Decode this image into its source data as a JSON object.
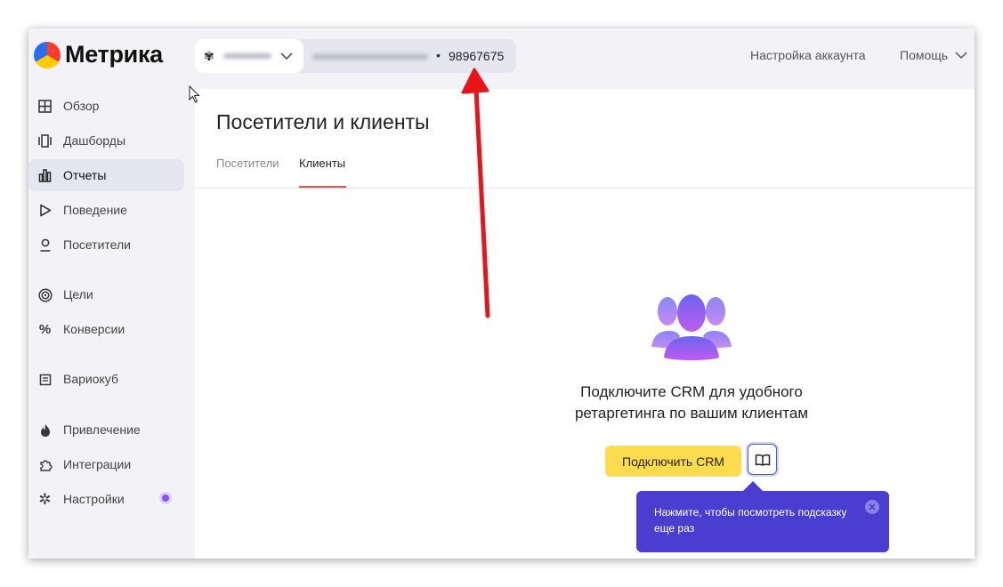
{
  "app": {
    "logo_text": "Метрика"
  },
  "header": {
    "counter_id": "98967675",
    "account_settings": "Настройка аккаунта",
    "help": "Помощь"
  },
  "sidebar": {
    "items": [
      {
        "label": "Обзор",
        "icon": "grid-icon"
      },
      {
        "label": "Дашборды",
        "icon": "dashboards-icon"
      },
      {
        "label": "Отчеты",
        "icon": "bar-chart-icon",
        "active": true
      },
      {
        "label": "Поведение",
        "icon": "play-icon"
      },
      {
        "label": "Посетители",
        "icon": "person-icon"
      },
      {
        "label": "Цели",
        "icon": "target-icon"
      },
      {
        "label": "Конверсии",
        "icon": "percent-icon"
      },
      {
        "label": "Вариокуб",
        "icon": "cube-icon"
      },
      {
        "label": "Привлечение",
        "icon": "flame-icon"
      },
      {
        "label": "Интеграции",
        "icon": "puzzle-icon"
      },
      {
        "label": "Настройки",
        "icon": "gear-icon"
      }
    ]
  },
  "main": {
    "title": "Посетители и клиенты",
    "tabs": [
      {
        "label": "Посетители",
        "active": false
      },
      {
        "label": "Клиенты",
        "active": true
      }
    ],
    "empty_title": "Подключите CRM для удобного ретаргетинга по вашим клиентам",
    "connect_button": "Подключить CRM",
    "tooltip_text": "Нажмите, чтобы посмотреть подсказку еще раз"
  },
  "colors": {
    "accent_yellow": "#ffdc4d",
    "tooltip_bg": "#4a3ed0",
    "tab_underline": "#e85050",
    "annotation_arrow": "#e8141a"
  }
}
